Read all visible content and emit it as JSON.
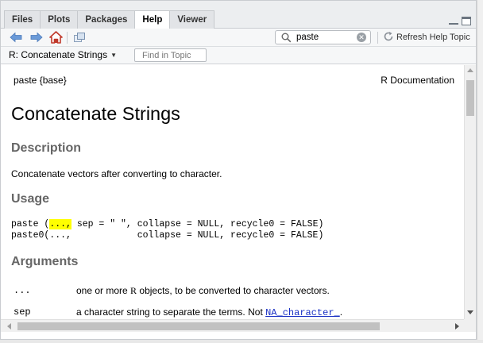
{
  "tabs": [
    {
      "label": "Files"
    },
    {
      "label": "Plots"
    },
    {
      "label": "Packages"
    },
    {
      "label": "Help",
      "active": true
    },
    {
      "label": "Viewer"
    }
  ],
  "toolbar": {
    "search_value": "paste",
    "refresh_label": "Refresh Help Topic",
    "icons": [
      "back-arrow-icon",
      "forward-arrow-icon",
      "home-icon",
      "popout-icon",
      "search-icon",
      "clear-icon",
      "refresh-icon"
    ]
  },
  "topic": {
    "selected": "R: Concatenate Strings",
    "find_placeholder": "Find in Topic"
  },
  "doc": {
    "header_left": "paste {base}",
    "header_right": "R Documentation",
    "title": "Concatenate Strings",
    "description_heading": "Description",
    "description_text": "Concatenate vectors after converting to character.",
    "usage_heading": "Usage",
    "usage_line1_pre": "paste (",
    "usage_line1_hl": "...,",
    "usage_line1_post": " sep = \" \", collapse = NULL, recycle0 = FALSE)",
    "usage_line2": "paste0(...,            collapse = NULL, recycle0 = FALSE)",
    "arguments_heading": "Arguments",
    "args": [
      {
        "name": "...",
        "desc_pre": "one or more ",
        "desc_r": "R",
        "desc_post": " objects, to be converted to character vectors.",
        "desc_link": ""
      },
      {
        "name": "sep",
        "desc_pre": "a character string to separate the terms. Not ",
        "desc_r": "",
        "desc_post": ".",
        "desc_link": "NA_character_"
      }
    ]
  },
  "colors": {
    "accent": "#1b31c4",
    "highlight": "#ffff00",
    "heading": "#666666"
  }
}
